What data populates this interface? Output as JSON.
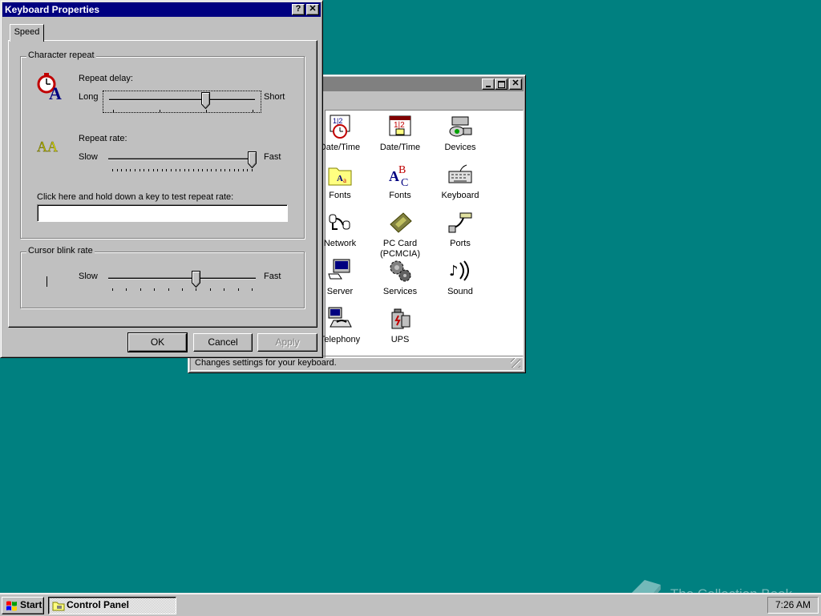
{
  "desktop_color": "#008080",
  "control_panel": {
    "status_text": "Changes settings for your keyboard.",
    "icons": [
      {
        "label": "Date/Time",
        "icon": "clock-calendar-icon"
      },
      {
        "label": "Date/Time",
        "icon": "calendar-icon"
      },
      {
        "label": "Devices",
        "icon": "devices-icon"
      },
      {
        "label": "Fonts",
        "icon": "fonts-folder-icon"
      },
      {
        "label": "Fonts",
        "icon": "fonts-abc-icon"
      },
      {
        "label": "Keyboard",
        "icon": "keyboard-icon"
      },
      {
        "label": "Network",
        "icon": "network-icon"
      },
      {
        "label": "PC Card (PCMCIA)",
        "icon": "pc-card-icon"
      },
      {
        "label": "Ports",
        "icon": "ports-icon"
      },
      {
        "label": "Server",
        "icon": "server-icon"
      },
      {
        "label": "Services",
        "icon": "services-icon"
      },
      {
        "label": "Sound",
        "icon": "sound-icon"
      },
      {
        "label": "Telephony",
        "icon": "telephony-icon"
      },
      {
        "label": "UPS",
        "icon": "ups-icon"
      }
    ]
  },
  "keyboard_dialog": {
    "title": "Keyboard Properties",
    "help_button": "?",
    "close_button": "✕",
    "tab_speed": "Speed",
    "character_repeat": {
      "group_label": "Character repeat",
      "repeat_delay_label": "Repeat delay:",
      "delay_left": "Long",
      "delay_right": "Short",
      "delay_level": 0.66,
      "repeat_rate_label": "Repeat rate:",
      "rate_left": "Slow",
      "rate_right": "Fast",
      "rate_level": 1.0,
      "test_label": "Click here and hold down a key to test repeat rate:",
      "test_value": ""
    },
    "cursor_blink": {
      "group_label": "Cursor blink rate",
      "left": "Slow",
      "right": "Fast",
      "level": 0.6
    },
    "buttons": {
      "ok": "OK",
      "cancel": "Cancel",
      "apply": "Apply"
    }
  },
  "taskbar": {
    "start_label": "Start",
    "task_control_panel": "Control Panel",
    "clock": "7:26 AM"
  },
  "watermark": "The Collection Book"
}
